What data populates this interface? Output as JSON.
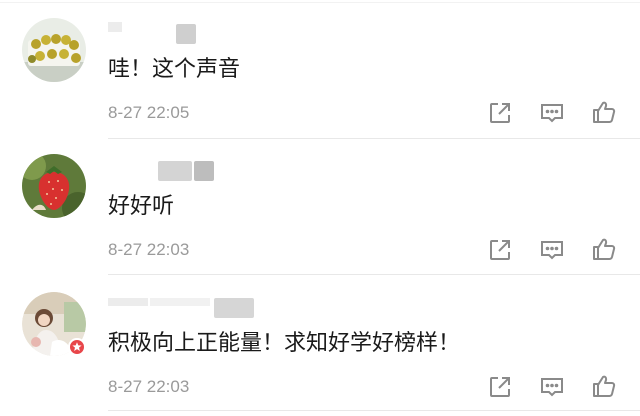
{
  "comments": [
    {
      "text": "哇！这个声音",
      "time": "8-27 22:05",
      "avatar_icon": "lemon-cakes-avatar",
      "actions": [
        "share-icon",
        "reply-icon",
        "like-icon"
      ]
    },
    {
      "text": "好好听",
      "time": "8-27 22:03",
      "avatar_icon": "strawberry-avatar",
      "actions": [
        "share-icon",
        "reply-icon",
        "like-icon"
      ]
    },
    {
      "text": "积极向上正能量！求知好学好榜样！",
      "time": "8-27 22:03",
      "avatar_icon": "portrait-avatar",
      "actions": [
        "share-icon",
        "reply-icon",
        "like-icon"
      ]
    }
  ],
  "colors": {
    "text": "#1a1a1a",
    "timestamp": "#9a9a9a",
    "icon": "#8a8a8a",
    "badge": "#e8464a"
  }
}
